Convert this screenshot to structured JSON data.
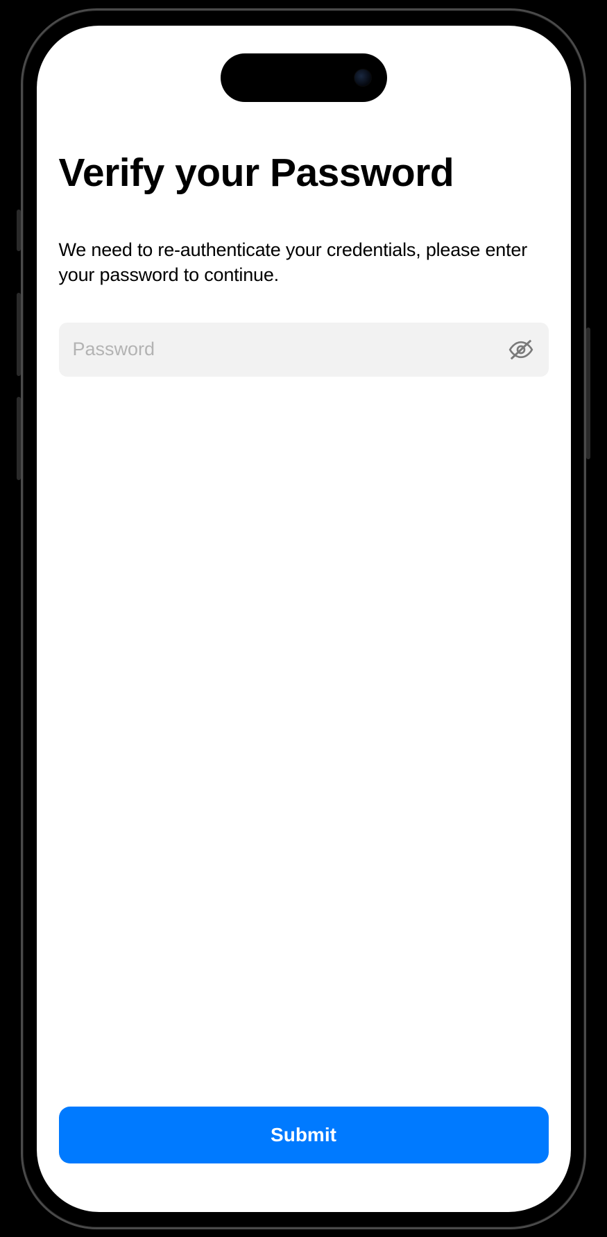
{
  "header": {
    "title": "Verify your Password"
  },
  "body": {
    "description": "We need to re-authenticate your credentials, please enter your password to continue."
  },
  "form": {
    "password": {
      "placeholder": "Password",
      "value": ""
    }
  },
  "actions": {
    "submit_label": "Submit"
  },
  "icons": {
    "toggle_visibility": "eye-off-icon"
  },
  "colors": {
    "primary": "#007aff",
    "input_bg": "#f2f2f2",
    "placeholder": "#b3b3b3"
  }
}
